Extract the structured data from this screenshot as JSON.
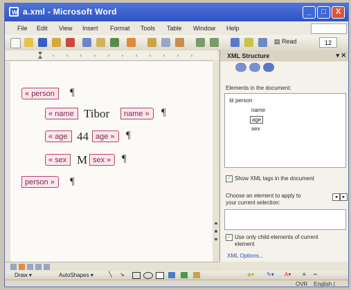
{
  "window": {
    "title": "a.xml - Microsoft Word",
    "controls": {
      "minimize": "_",
      "maximize": "□",
      "close": "X"
    }
  },
  "menu": [
    "File",
    "Edit",
    "View",
    "Insert",
    "Format",
    "Tools",
    "Table",
    "Window",
    "Help"
  ],
  "toolbar": {
    "read_label": "Read",
    "font_size": "12"
  },
  "document": {
    "root_tag": "person",
    "fields": [
      {
        "tag": "name",
        "value": "Tibor"
      },
      {
        "tag": "age",
        "value": "44"
      },
      {
        "tag": "sex",
        "value": "M"
      }
    ],
    "pilcrow": "¶"
  },
  "xml_pane": {
    "title": "XML Structure",
    "elements_label": "Elements in the document:",
    "tree": {
      "root": "person",
      "children": [
        "name",
        "age",
        "sex"
      ],
      "selected": "age"
    },
    "show_tags_label": "Show XML tags in the document",
    "choose_label_1": "Choose an element to apply to",
    "choose_label_2": "your current selection:",
    "only_child_label_1": "Use only child elements of current",
    "only_child_label_2": "element",
    "options_link": "XML Options..."
  },
  "drawing_toolbar": {
    "draw_label": "Draw",
    "autoshapes_label": "AutoShapes"
  },
  "status": {
    "ovr": "OVR",
    "language": "English ("
  },
  "colors": {
    "title_bar": "#2d54c6",
    "tag_border": "#b6426e",
    "tag_fill": "#fde6ee"
  },
  "icons": [
    "word-app-icon",
    "new-icon",
    "open-icon",
    "save-icon",
    "print-icon",
    "spelling-icon",
    "undo-icon",
    "redo-icon",
    "read-icon"
  ]
}
